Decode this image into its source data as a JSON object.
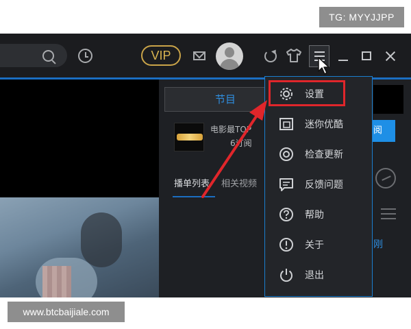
{
  "watermarks": {
    "top": "TG: MYYJJPP",
    "bottom": "www.btcbaijiale.com"
  },
  "titlebar": {
    "vip_label": "VIP"
  },
  "panel": {
    "tab_programs": "节目",
    "program_title": "电影最TOP",
    "program_subs": "6订阅",
    "subscribe_label": "阅",
    "tab_playlist": "播单列表",
    "tab_related": "相关视频",
    "side_label": "刚"
  },
  "menu": {
    "items": [
      {
        "label": "设置",
        "icon": "gear-icon"
      },
      {
        "label": "迷你优酷",
        "icon": "mini-player-icon"
      },
      {
        "label": "检查更新",
        "icon": "update-check-icon"
      },
      {
        "label": "反馈问题",
        "icon": "feedback-icon"
      },
      {
        "label": "帮助",
        "icon": "help-icon"
      },
      {
        "label": "关于",
        "icon": "info-icon"
      },
      {
        "label": "退出",
        "icon": "power-icon"
      }
    ]
  },
  "colors": {
    "accent": "#1b6ec2",
    "highlight": "#e0262b",
    "vip": "#caa449"
  }
}
